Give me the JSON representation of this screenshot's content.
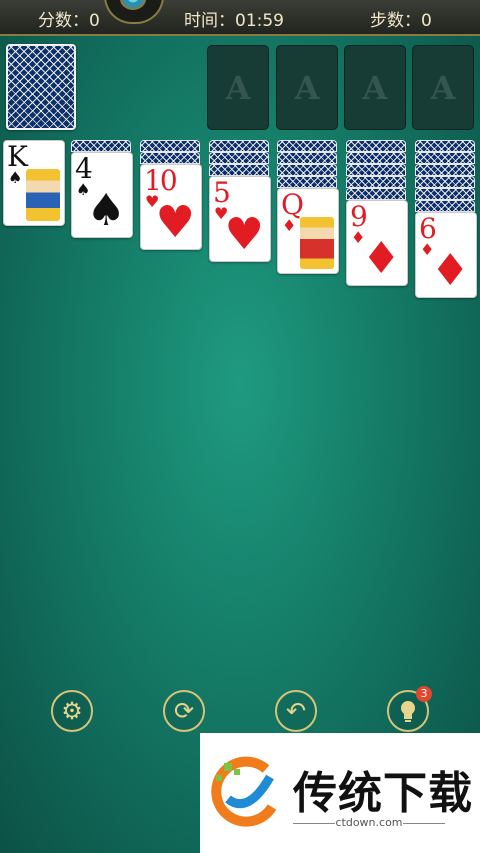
{
  "top_bar": {
    "score_label": "分数：",
    "score_value": "0",
    "time_label": "时间：",
    "time_value": "01:59",
    "moves_label": "步数：",
    "moves_value": "0"
  },
  "foundations": [
    "A",
    "A",
    "A",
    "A"
  ],
  "tableau": [
    {
      "rank": "K",
      "suit": "♠",
      "color": "black",
      "hidden_count": 0
    },
    {
      "rank": "4",
      "suit": "♠",
      "color": "black",
      "hidden_count": 1
    },
    {
      "rank": "10",
      "suit": "♥",
      "color": "red",
      "hidden_count": 2
    },
    {
      "rank": "5",
      "suit": "♥",
      "color": "red",
      "hidden_count": 3
    },
    {
      "rank": "Q",
      "suit": "♦",
      "color": "red",
      "hidden_count": 4
    },
    {
      "rank": "9",
      "suit": "♦",
      "color": "red",
      "hidden_count": 5
    },
    {
      "rank": "6",
      "suit": "♦",
      "color": "red",
      "hidden_count": 6
    }
  ],
  "toolbar": {
    "settings_icon": "gear-icon",
    "new_game_icon": "refresh-icon",
    "undo_icon": "undo-icon",
    "hint_icon": "lightbulb-icon",
    "hint_count": "3"
  },
  "watermark": {
    "title": "传统下载",
    "url": "ctdown.com"
  },
  "colors": {
    "felt": "#147a66",
    "gold": "#d7c37a",
    "red_suit": "#e11c22"
  }
}
